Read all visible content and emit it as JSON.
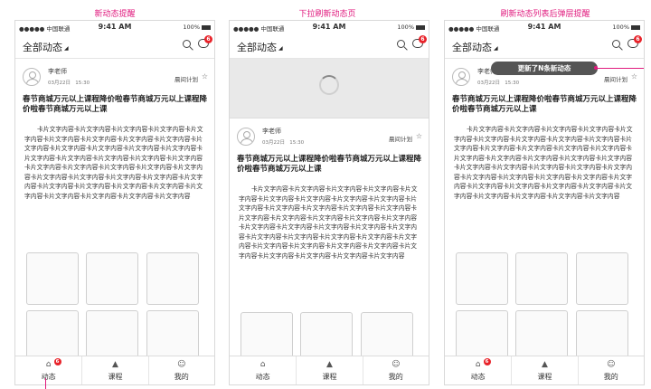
{
  "captions": [
    "新动态提醒",
    "下拉刷新动态页",
    "刷新动态列表后弹层提醒"
  ],
  "status": {
    "carrier": "●●●●● 中国联通",
    "time": "9:41 AM",
    "battery": "100%"
  },
  "nav": {
    "title": "全部动态",
    "badge": "6"
  },
  "post": {
    "author": "李老师",
    "date": "03月22日",
    "time": "15:30",
    "plan": "晨间计划",
    "title": "春节商城万元以上课程降价啦春节商城万元以上课程降价啦春节商城万元以上课",
    "body": "卡片文字内容卡片文字内容卡片文字内容卡片文字内容卡片文字内容卡片文字内容卡片文字内容卡片文字内容卡片文字内容卡片文字内容卡片文字内容卡片文字内容卡片文字内容卡片文字内容卡片文字内容卡片文字内容卡片文字内容卡片文字内容卡片文字内容卡片文字内容卡片文字内容卡片文字内容卡片文字内容卡片文字内容卡片文字内容卡片文字内容卡片文字内容卡片文字内容卡片文字内容卡片文字内容卡片文字内容卡片文字内容卡片文字内容卡片文字内容卡片文字内容卡片文字内容卡片文字内容卡片文字内容"
  },
  "tabs": [
    {
      "label": "动态",
      "badge": "6"
    },
    {
      "label": "课程"
    },
    {
      "label": "我的"
    }
  ],
  "toast": "更新了N条新动态",
  "colors": {
    "annotation": "#e0197d",
    "badge": "#e8232a",
    "toast_bg": "#555555"
  },
  "icons": [
    "search-icon",
    "message-icon",
    "star-icon",
    "home-icon",
    "graduation-cap-icon",
    "user-icon",
    "spinner-icon",
    "avatar-icon"
  ]
}
